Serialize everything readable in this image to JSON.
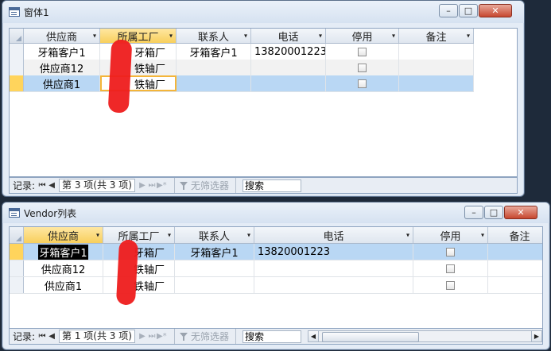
{
  "colors": {
    "header_selected": "#f8cf5c",
    "row_active": "#b9d7f4",
    "redaction": "#ee1c1c",
    "window_bg": "#e4ecf6"
  },
  "window1": {
    "title": "窗体1",
    "controls": {
      "minimize": "–",
      "maximize": "□",
      "close": "✕"
    },
    "columns": [
      "供应商",
      "所属工厂",
      "联系人",
      "电话",
      "停用",
      "备注"
    ],
    "rows": [
      {
        "supplier": "牙箱客户1",
        "factory": "牙箱厂",
        "contact": "牙箱客户1",
        "phone": "13820001223",
        "disabled": false,
        "note": ""
      },
      {
        "supplier": "供应商12",
        "factory": "铁轴厂",
        "contact": "",
        "phone": "",
        "disabled": false,
        "note": ""
      },
      {
        "supplier": "供应商1",
        "factory": "铁轴厂",
        "contact": "",
        "phone": "",
        "disabled": false,
        "note": ""
      }
    ],
    "nav": {
      "label": "记录:",
      "position": "第 3 项(共 3 项)",
      "filter": "无筛选器",
      "search": "搜索",
      "first": "⏮",
      "prev": "◀",
      "next": "▶",
      "last": "⏭",
      "new": "▶*"
    }
  },
  "window2": {
    "title": "Vendor列表",
    "controls": {
      "minimize": "–",
      "maximize": "□",
      "close": "✕"
    },
    "columns": [
      "供应商",
      "所属工厂",
      "联系人",
      "电话",
      "停用",
      "备注"
    ],
    "rows": [
      {
        "supplier": "牙箱客户1",
        "factory": "牙箱厂",
        "contact": "牙箱客户1",
        "phone": "13820001223",
        "disabled": false,
        "note": ""
      },
      {
        "supplier": "供应商12",
        "factory": "铁轴厂",
        "contact": "",
        "phone": "",
        "disabled": false,
        "note": ""
      },
      {
        "supplier": "供应商1",
        "factory": "铁轴厂",
        "contact": "",
        "phone": "",
        "disabled": false,
        "note": ""
      }
    ],
    "nav": {
      "label": "记录:",
      "position": "第 1 项(共 3 项)",
      "filter": "无筛选器",
      "search": "搜索",
      "first": "⏮",
      "prev": "◀",
      "next": "▶",
      "last": "⏭",
      "new": "▶*"
    }
  },
  "icons": {
    "form": "form-icon",
    "filter": "filter-icon",
    "dropdown": "▾",
    "scroll_left": "◀",
    "scroll_right": "▶"
  }
}
